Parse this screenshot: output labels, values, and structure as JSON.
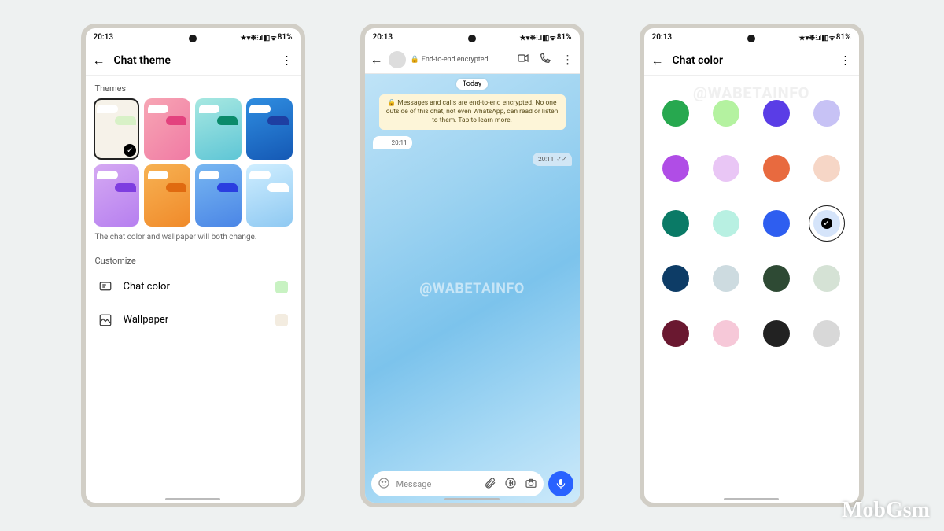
{
  "status": {
    "time": "20:13",
    "battery": "81%",
    "icons_text": "★ ▾ ❉ ⫶ .ıl ▮▯ ᯤ"
  },
  "watermark_source": "@WABETAINFO",
  "watermark_site": "MobGsm",
  "phone1": {
    "title": "Chat theme",
    "themes_label": "Themes",
    "themes": [
      {
        "bg": "#f6f2e9",
        "out": "#d8f1c7",
        "selected": true
      },
      {
        "bg": "linear-gradient(135deg,#f7a6b4,#f07aa4)",
        "out": "#e3427e"
      },
      {
        "bg": "linear-gradient(160deg,#a7e8e1,#5fc6d6)",
        "out": "#0a8a6a"
      },
      {
        "bg": "linear-gradient(160deg,#2f8de0,#1559b5)",
        "out": "#1e3fa2"
      },
      {
        "bg": "linear-gradient(150deg,#d5a9f2,#b67ff0)",
        "out": "#7e3de0"
      },
      {
        "bg": "linear-gradient(150deg,#f7b253,#f08a2a)",
        "out": "#e06a10"
      },
      {
        "bg": "linear-gradient(160deg,#78b7f1,#4b86e6)",
        "out": "#2a3ee0"
      },
      {
        "bg": "linear-gradient(160deg,#cfeeff,#8fc9f2)",
        "out": "#ffffff"
      }
    ],
    "help": "The chat color and wallpaper will both change.",
    "customize_label": "Customize",
    "row_color": {
      "label": "Chat color",
      "swatch": "#c8f2c2"
    },
    "row_wall": {
      "label": "Wallpaper",
      "swatch": "#f3ece0"
    }
  },
  "phone2": {
    "enc_label": "End-to-end encrypted",
    "today": "Today",
    "banner": "Messages and calls are end-to-end encrypted. No one outside of this chat, not even WhatsApp, can read or listen to them. Tap to learn more.",
    "msg_in_time": "20:11",
    "msg_out_time": "20:11",
    "input_placeholder": "Message"
  },
  "phone3": {
    "title": "Chat color",
    "colors": [
      {
        "c": "#27a84f"
      },
      {
        "c": "#b4f2a0"
      },
      {
        "c": "#5a3de6"
      },
      {
        "c": "#c7c2f5"
      },
      {
        "c": "#b04de6"
      },
      {
        "c": "#e9c6f5"
      },
      {
        "c": "#e86a3f"
      },
      {
        "c": "#f6d6c6"
      },
      {
        "c": "#0a7a66"
      },
      {
        "c": "#b8f0e2"
      },
      {
        "c": "#2e5ef0"
      },
      {
        "c": "#d5e4fa",
        "selected": true
      },
      {
        "c": "#0d3c66"
      },
      {
        "c": "#cddbe0"
      },
      {
        "c": "#2e4a34"
      },
      {
        "c": "#d5e2d5"
      },
      {
        "c": "#6a1830"
      },
      {
        "c": "#f6c8d8"
      },
      {
        "c": "#222222"
      },
      {
        "c": "#d8d8d8"
      }
    ]
  }
}
